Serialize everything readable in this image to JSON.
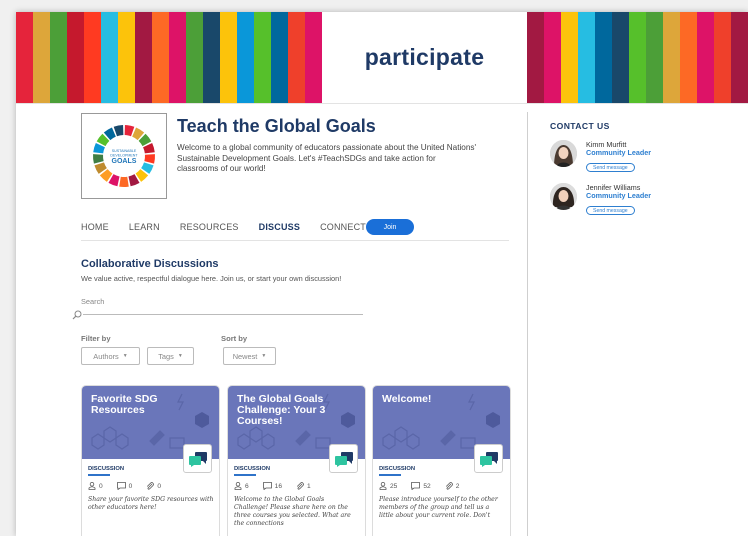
{
  "banner": {
    "brand": "participate",
    "left_stripes": [
      "#e5243b",
      "#dda63a",
      "#4c9f38",
      "#c5192d",
      "#ff3a21",
      "#26bde2",
      "#fcc30b",
      "#a21942",
      "#fd6925",
      "#dd1367",
      "#4c9f38",
      "#19486a",
      "#fcc30b",
      "#0a97d9",
      "#56c02b",
      "#00689d",
      "#ef402b",
      "#dd1367"
    ],
    "right_stripes": [
      "#a21942",
      "#dd1367",
      "#fcc30b",
      "#26bde2",
      "#00689d",
      "#19486a",
      "#56c02b",
      "#4c9f38",
      "#dda63a",
      "#fd6925",
      "#dd1367",
      "#ef402b",
      "#a21942"
    ]
  },
  "community": {
    "logo_text": [
      "SUSTAINABLE",
      "DEVELOPMENT",
      "GOALS"
    ],
    "title": "Teach the Global Goals",
    "description": "Welcome to a global community of educators passionate about the United Nations' Sustainable Development Goals. Let's #TeachSDGs and take action for classrooms of our world!"
  },
  "nav": {
    "items": [
      "HOME",
      "LEARN",
      "RESOURCES",
      "DISCUSS",
      "CONNECT"
    ],
    "active": "DISCUSS",
    "join_label": "Join"
  },
  "discussions": {
    "title": "Collaborative Discussions",
    "subtitle": "We value active, respectful dialogue here. Join us, or start your own discussion!",
    "search_label": "Search",
    "filter_label": "Filter by",
    "sort_label": "Sort by",
    "filter_authors": "Authors",
    "filter_tags": "Tags",
    "sort_value": "Newest"
  },
  "cards": [
    {
      "title": "Favorite SDG Resources",
      "type": "DISCUSSION",
      "members": "0",
      "comments": "0",
      "attachments": "0",
      "text": "Share your favorite SDG resources with other educators here!"
    },
    {
      "title": "The Global Goals Challenge: Your 3 Courses!",
      "type": "DISCUSSION",
      "members": "6",
      "comments": "16",
      "attachments": "1",
      "text": "Welcome to the Global Goals Challenge! Please share here on the three courses you selected. What are the connections"
    },
    {
      "title": "Welcome!",
      "type": "DISCUSSION",
      "members": "25",
      "comments": "52",
      "attachments": "2",
      "text": "Please introduce yourself to the other members of the group and tell us a little about your current role. Don't"
    }
  ],
  "contact": {
    "title": "CONTACT US",
    "people": [
      {
        "name": "Kimm Murfitt",
        "role": "Community Leader",
        "button": "Send message"
      },
      {
        "name": "Jennifer Williams",
        "role": "Community Leader",
        "button": "Send message"
      }
    ]
  },
  "colors": {
    "card_header": "#6a76ba",
    "brand_navy": "#1f3a66",
    "accent_blue": "#1a6fd8"
  }
}
